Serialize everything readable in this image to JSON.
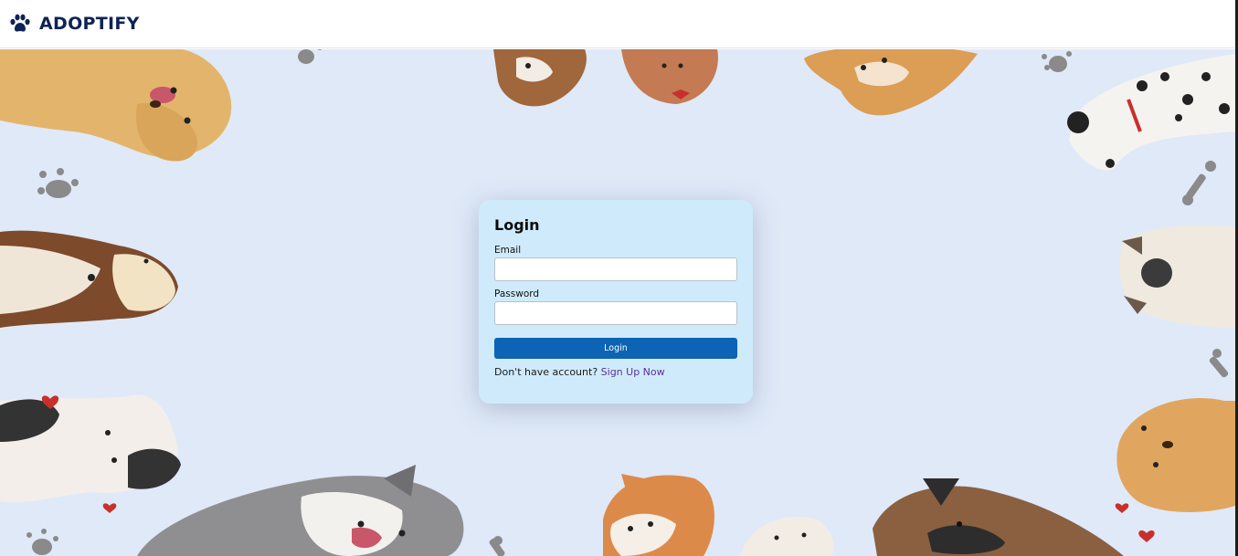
{
  "brand": {
    "name": "ADOPTIFY",
    "icon": "paw-icon",
    "color": "#0e2356"
  },
  "background": {
    "description_icons": [
      "paw-print-icon",
      "bone-icon",
      "heart-icon",
      "dog-illustration"
    ],
    "color": "#dfe9f8"
  },
  "login": {
    "title": "Login",
    "email_label": "Email",
    "email_value": "",
    "password_label": "Password",
    "password_value": "",
    "button_label": "Login",
    "signup_prompt": "Don't have account?",
    "signup_link": "Sign Up Now",
    "card_color": "#cfebfb",
    "button_color": "#0d63b4",
    "link_color": "#5b2f96"
  }
}
